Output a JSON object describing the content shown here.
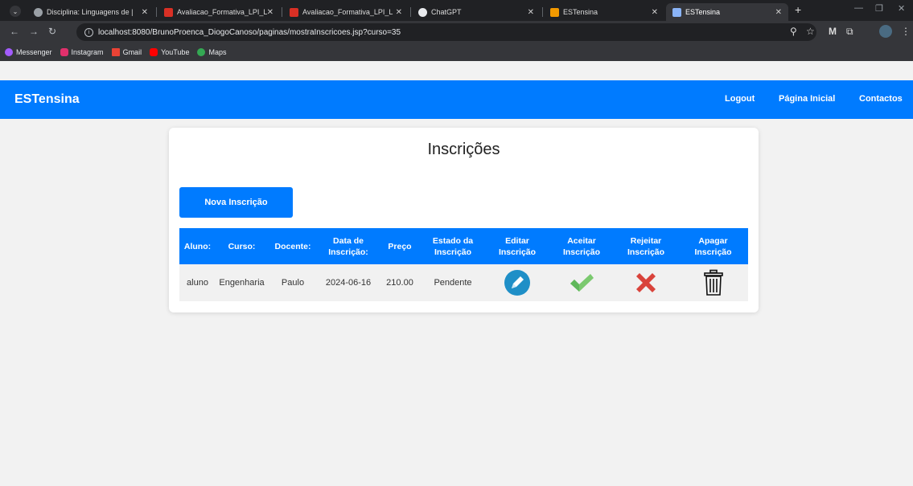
{
  "browser": {
    "tabs": [
      {
        "label": "Disciplina: Linguagens de |"
      },
      {
        "label": "Avaliacao_Formativa_LPI_L"
      },
      {
        "label": "Avaliacao_Formativa_LPI_L"
      },
      {
        "label": "ChatGPT"
      },
      {
        "label": "ESTensina"
      },
      {
        "label": "ESTensina"
      }
    ],
    "url": "localhost:8080/BrunoProenca_DiogoCanoso/paginas/mostraInscricoes.jsp?curso=35",
    "bookmarks": [
      {
        "label": "Messenger"
      },
      {
        "label": "Instagram"
      },
      {
        "label": "Gmail"
      },
      {
        "label": "YouTube"
      },
      {
        "label": "Maps"
      }
    ]
  },
  "navbar": {
    "brand": "ESTensina",
    "links": {
      "logout": "Logout",
      "home": "Página Inicial",
      "contacts": "Contactos"
    },
    "color": "#007bff"
  },
  "page": {
    "title": "Inscrições",
    "new_button": "Nova Inscrição"
  },
  "table": {
    "headers": {
      "aluno": "Aluno:",
      "curso": "Curso:",
      "docente": "Docente:",
      "data_l1": "Data de",
      "data_l2": "Inscrição:",
      "preco": "Preço",
      "estado_l1": "Estado da",
      "estado_l2": "Inscrição",
      "editar_l1": "Editar",
      "editar_l2": "Inscrição",
      "aceitar_l1": "Aceitar",
      "aceitar_l2": "Inscrição",
      "rejeitar_l1": "Rejeitar",
      "rejeitar_l2": "Inscrição",
      "apagar_l1": "Apagar",
      "apagar_l2": "Inscrição"
    },
    "rows": [
      {
        "aluno": "aluno",
        "curso": "Engenharia",
        "docente": "Paulo",
        "data": "2024-06-16",
        "preco": "210.00",
        "estado": "Pendente",
        "icons": {
          "edit": "pencil-icon",
          "accept": "check-icon",
          "reject": "x-icon",
          "delete": "trash-icon"
        }
      }
    ]
  }
}
